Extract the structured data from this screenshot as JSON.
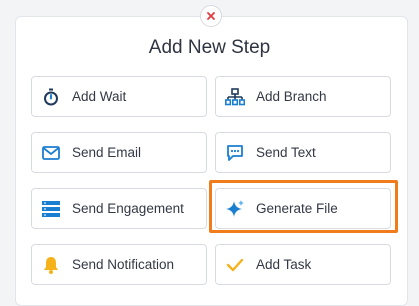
{
  "dialog": {
    "title": "Add New Step"
  },
  "colors": {
    "accent": "#1b7fd1",
    "highlight": "#f07c1b",
    "bell": "#f5b21b",
    "check": "#f5b21b",
    "sparkle": "#1b7fd1"
  },
  "options": [
    {
      "label": "Add Wait",
      "icon": "stopwatch-icon"
    },
    {
      "label": "Add Branch",
      "icon": "hierarchy-icon"
    },
    {
      "label": "Send Email",
      "icon": "envelope-icon"
    },
    {
      "label": "Send Text",
      "icon": "chat-bubble-icon"
    },
    {
      "label": "Send Engagement",
      "icon": "stack-icon"
    },
    {
      "label": "Generate File",
      "icon": "sparkle-icon"
    },
    {
      "label": "Send Notification",
      "icon": "bell-icon"
    },
    {
      "label": "Add Task",
      "icon": "checkmark-icon"
    }
  ]
}
